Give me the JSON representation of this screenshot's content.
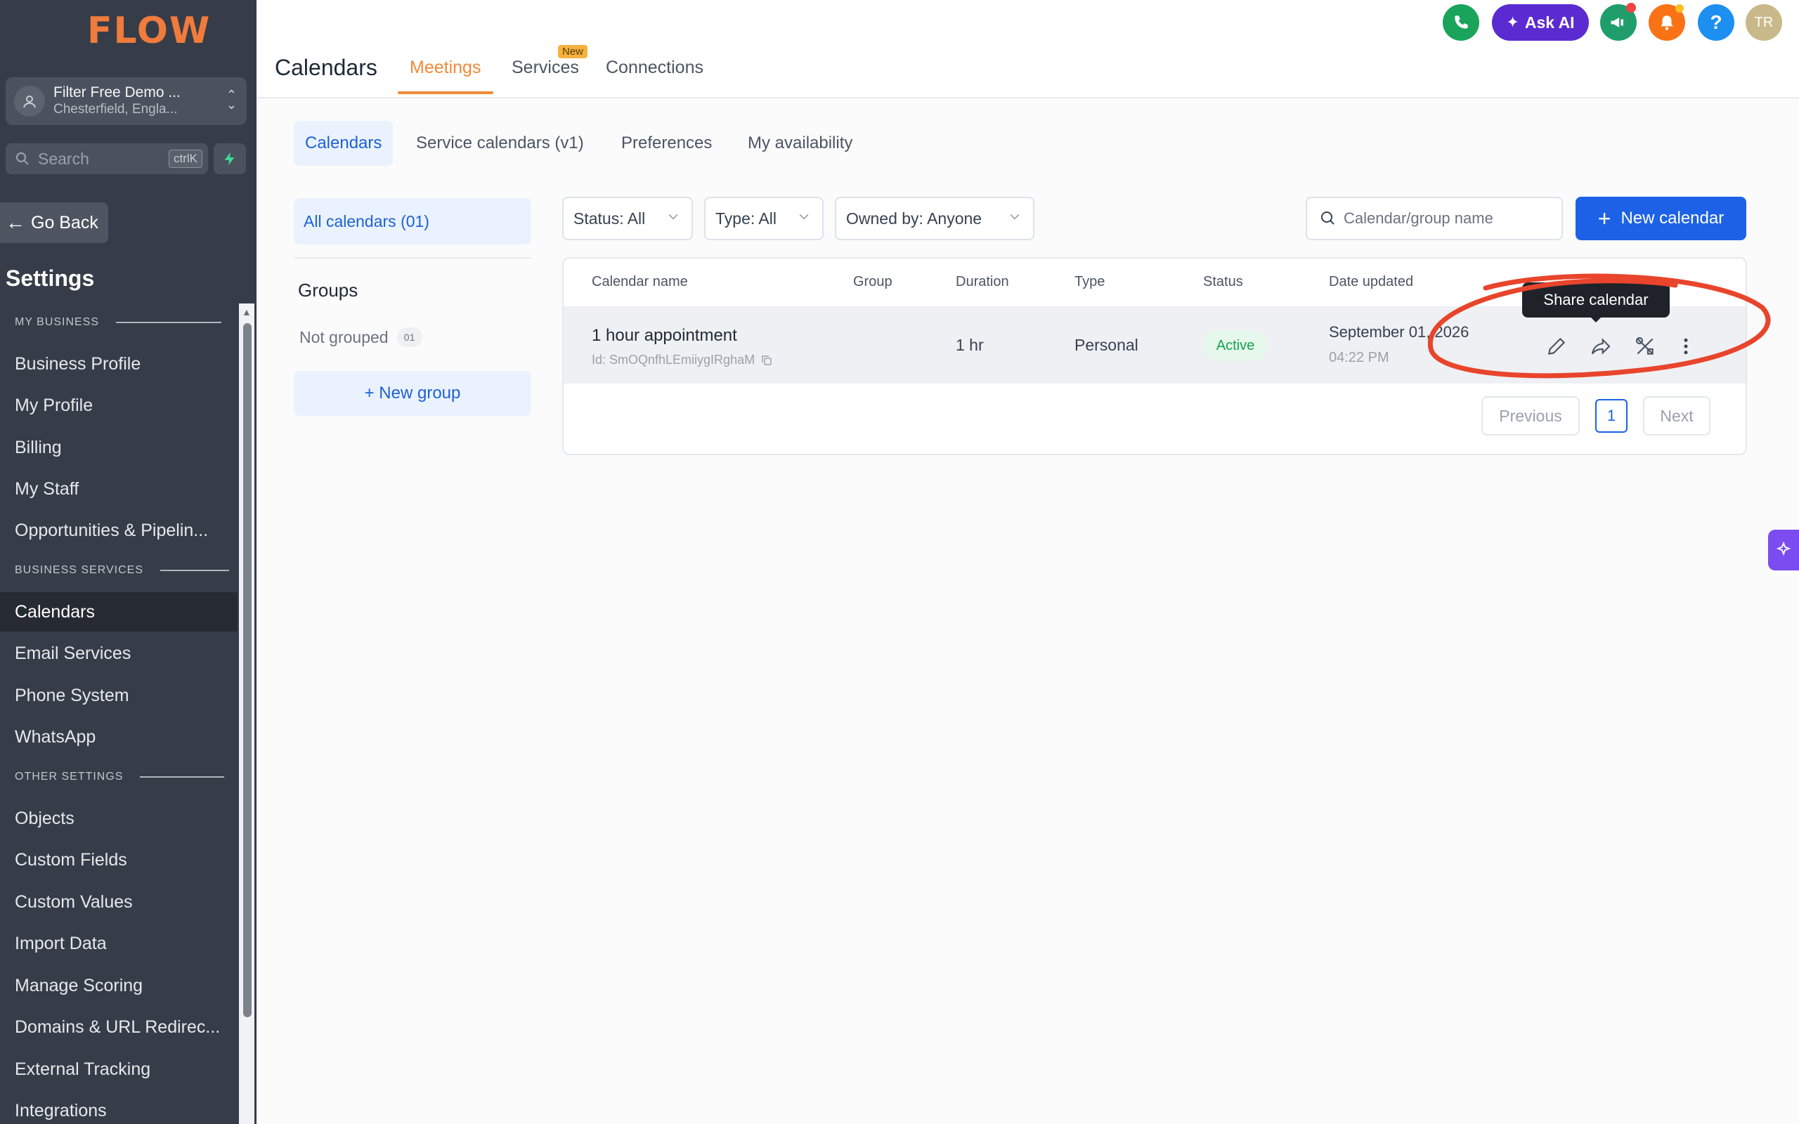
{
  "brand": {
    "logo_text": "FLOW",
    "accent": "#f08a3a",
    "primary": "#1d62e6"
  },
  "account": {
    "name": "Filter Free Demo ...",
    "location": "Chesterfield, Engla..."
  },
  "sidebar": {
    "search_placeholder": "Search",
    "search_shortcut": "ctrlK",
    "go_back": "Go Back",
    "title": "Settings",
    "sections": {
      "my_business": "MY BUSINESS",
      "business_services": "BUSINESS SERVICES",
      "other_settings": "OTHER SETTINGS"
    },
    "items": [
      "Business Profile",
      "My Profile",
      "Billing",
      "My Staff",
      "Opportunities & Pipelin...",
      "Calendars",
      "Email Services",
      "Phone System",
      "WhatsApp",
      "Objects",
      "Custom Fields",
      "Custom Values",
      "Import Data",
      "Manage Scoring",
      "Domains & URL Redirec...",
      "External Tracking",
      "Integrations"
    ],
    "active_item": "Calendars"
  },
  "header": {
    "title": "Calendars",
    "tabs": [
      "Meetings",
      "Services",
      "Connections"
    ],
    "active_tab": "Meetings",
    "new_badge": "New",
    "ask_ai": "Ask AI",
    "help": "?",
    "avatar_initials": "TR"
  },
  "subtabs": [
    "Calendars",
    "Service calendars (v1)",
    "Preferences",
    "My availability"
  ],
  "left_panel": {
    "all_calendars": "All calendars (01)",
    "groups_heading": "Groups",
    "not_grouped": "Not grouped",
    "not_grouped_count": "01",
    "new_group": "+ New group"
  },
  "filters": {
    "status": "Status: All",
    "type": "Type: All",
    "owner": "Owned by: Anyone",
    "search_placeholder": "Calendar/group name",
    "new_calendar": "New calendar"
  },
  "table": {
    "columns": [
      "Calendar name",
      "Group",
      "Duration",
      "Type",
      "Status",
      "Date updated"
    ],
    "rows": [
      {
        "name": "1 hour appointment",
        "id": "Id: SmOQnfhLEmiiygIRghaM",
        "group": "",
        "duration": "1 hr",
        "type": "Personal",
        "status": "Active",
        "date": "September 01, 2026",
        "time": "04:22 PM"
      }
    ],
    "tooltip": "Share calendar"
  },
  "pagination": {
    "previous": "Previous",
    "page": "1",
    "next": "Next"
  }
}
